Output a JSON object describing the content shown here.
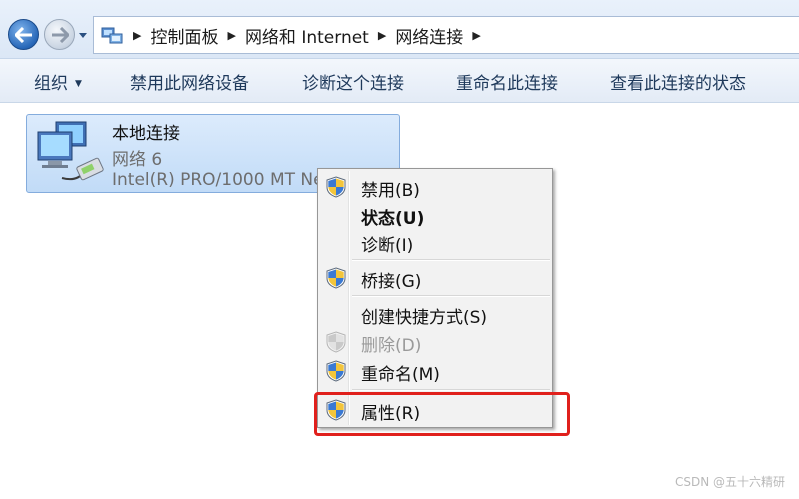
{
  "breadcrumb": {
    "items": [
      "控制面板",
      "网络和 Internet",
      "网络连接"
    ]
  },
  "command_bar": {
    "organize": "组织",
    "disable_device": "禁用此网络设备",
    "diagnose": "诊断这个连接",
    "rename": "重命名此连接",
    "view_status": "查看此连接的状态"
  },
  "connection": {
    "name": "本地连接",
    "network": "网络  6",
    "device": "Intel(R) PRO/1000 MT Network Connection"
  },
  "context_menu": {
    "items": [
      {
        "label": "禁用(B)",
        "shield": true
      },
      {
        "label": "状态(U)",
        "bold": true
      },
      {
        "label": "诊断(I)"
      },
      {
        "label": "桥接(G)",
        "shield": true
      },
      {
        "label": "创建快捷方式(S)"
      },
      {
        "label": "删除(D)",
        "shield": true,
        "disabled": true
      },
      {
        "label": "重命名(M)",
        "shield": true
      },
      {
        "label": "属性(R)",
        "shield": true,
        "highlighted": true
      }
    ]
  },
  "colors": {
    "highlight_border": "#e0201c",
    "tile_selected": "#c1dbf7"
  },
  "watermark": "CSDN @五十六精研"
}
